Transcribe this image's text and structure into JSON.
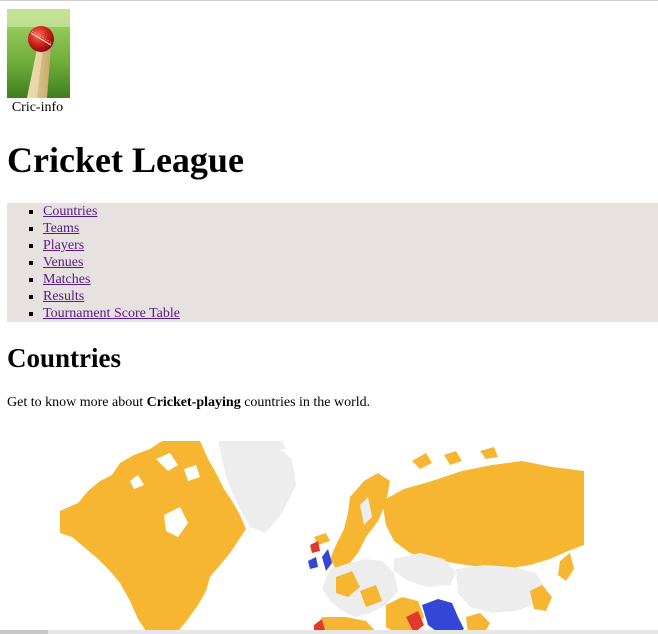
{
  "logo": {
    "caption": "Cric-info",
    "icon": "cricket-ball-bat-icon"
  },
  "header": {
    "title": "Cricket League"
  },
  "nav": {
    "items": [
      {
        "label": "Countries"
      },
      {
        "label": "Teams"
      },
      {
        "label": "Players"
      },
      {
        "label": "Venues"
      },
      {
        "label": "Matches"
      },
      {
        "label": "Results"
      },
      {
        "label": "Tournament Score Table"
      }
    ]
  },
  "main": {
    "section_title": "Countries",
    "intro_before": "Get to know more about ",
    "intro_bold": "Cricket-playing",
    "intro_after": " countries in the world."
  },
  "map": {
    "icon": "world-map-icon",
    "colors": {
      "cricket_country": "#f6b632",
      "highlight": "#3346d6",
      "accent": "#e03a2a",
      "other": "#ededed"
    }
  },
  "colors": {
    "nav_background": "#e7e2df",
    "link": "#551a8b"
  }
}
